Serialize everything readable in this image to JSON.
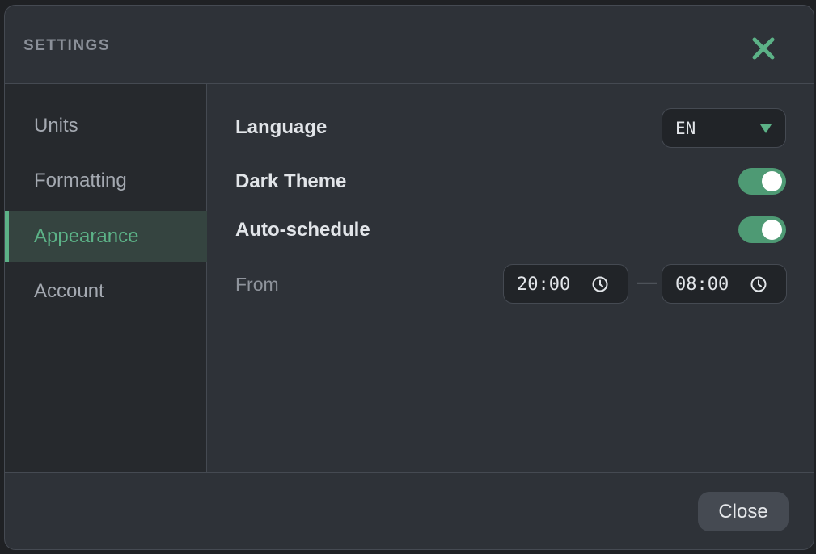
{
  "dialog": {
    "title": "SETTINGS"
  },
  "sidebar": {
    "items": [
      {
        "label": "Units",
        "active": false
      },
      {
        "label": "Formatting",
        "active": false
      },
      {
        "label": "Appearance",
        "active": true
      },
      {
        "label": "Account",
        "active": false
      }
    ]
  },
  "appearance": {
    "language_label": "Language",
    "language_value": "EN",
    "dark_theme_label": "Dark Theme",
    "dark_theme_on": true,
    "auto_schedule_label": "Auto-schedule",
    "auto_schedule_on": true,
    "from_label": "From",
    "from_time": "20:00",
    "to_time": "08:00",
    "range_separator": "—"
  },
  "footer": {
    "close_label": "Close"
  },
  "icons": {
    "close": "close-icon",
    "dropdown": "caret-down-icon",
    "clock": "clock-icon"
  },
  "colors": {
    "accent": "#5cb287",
    "toggle_on": "#4e9a74",
    "panel": "#2e3238",
    "sidebar": "#26292d"
  }
}
